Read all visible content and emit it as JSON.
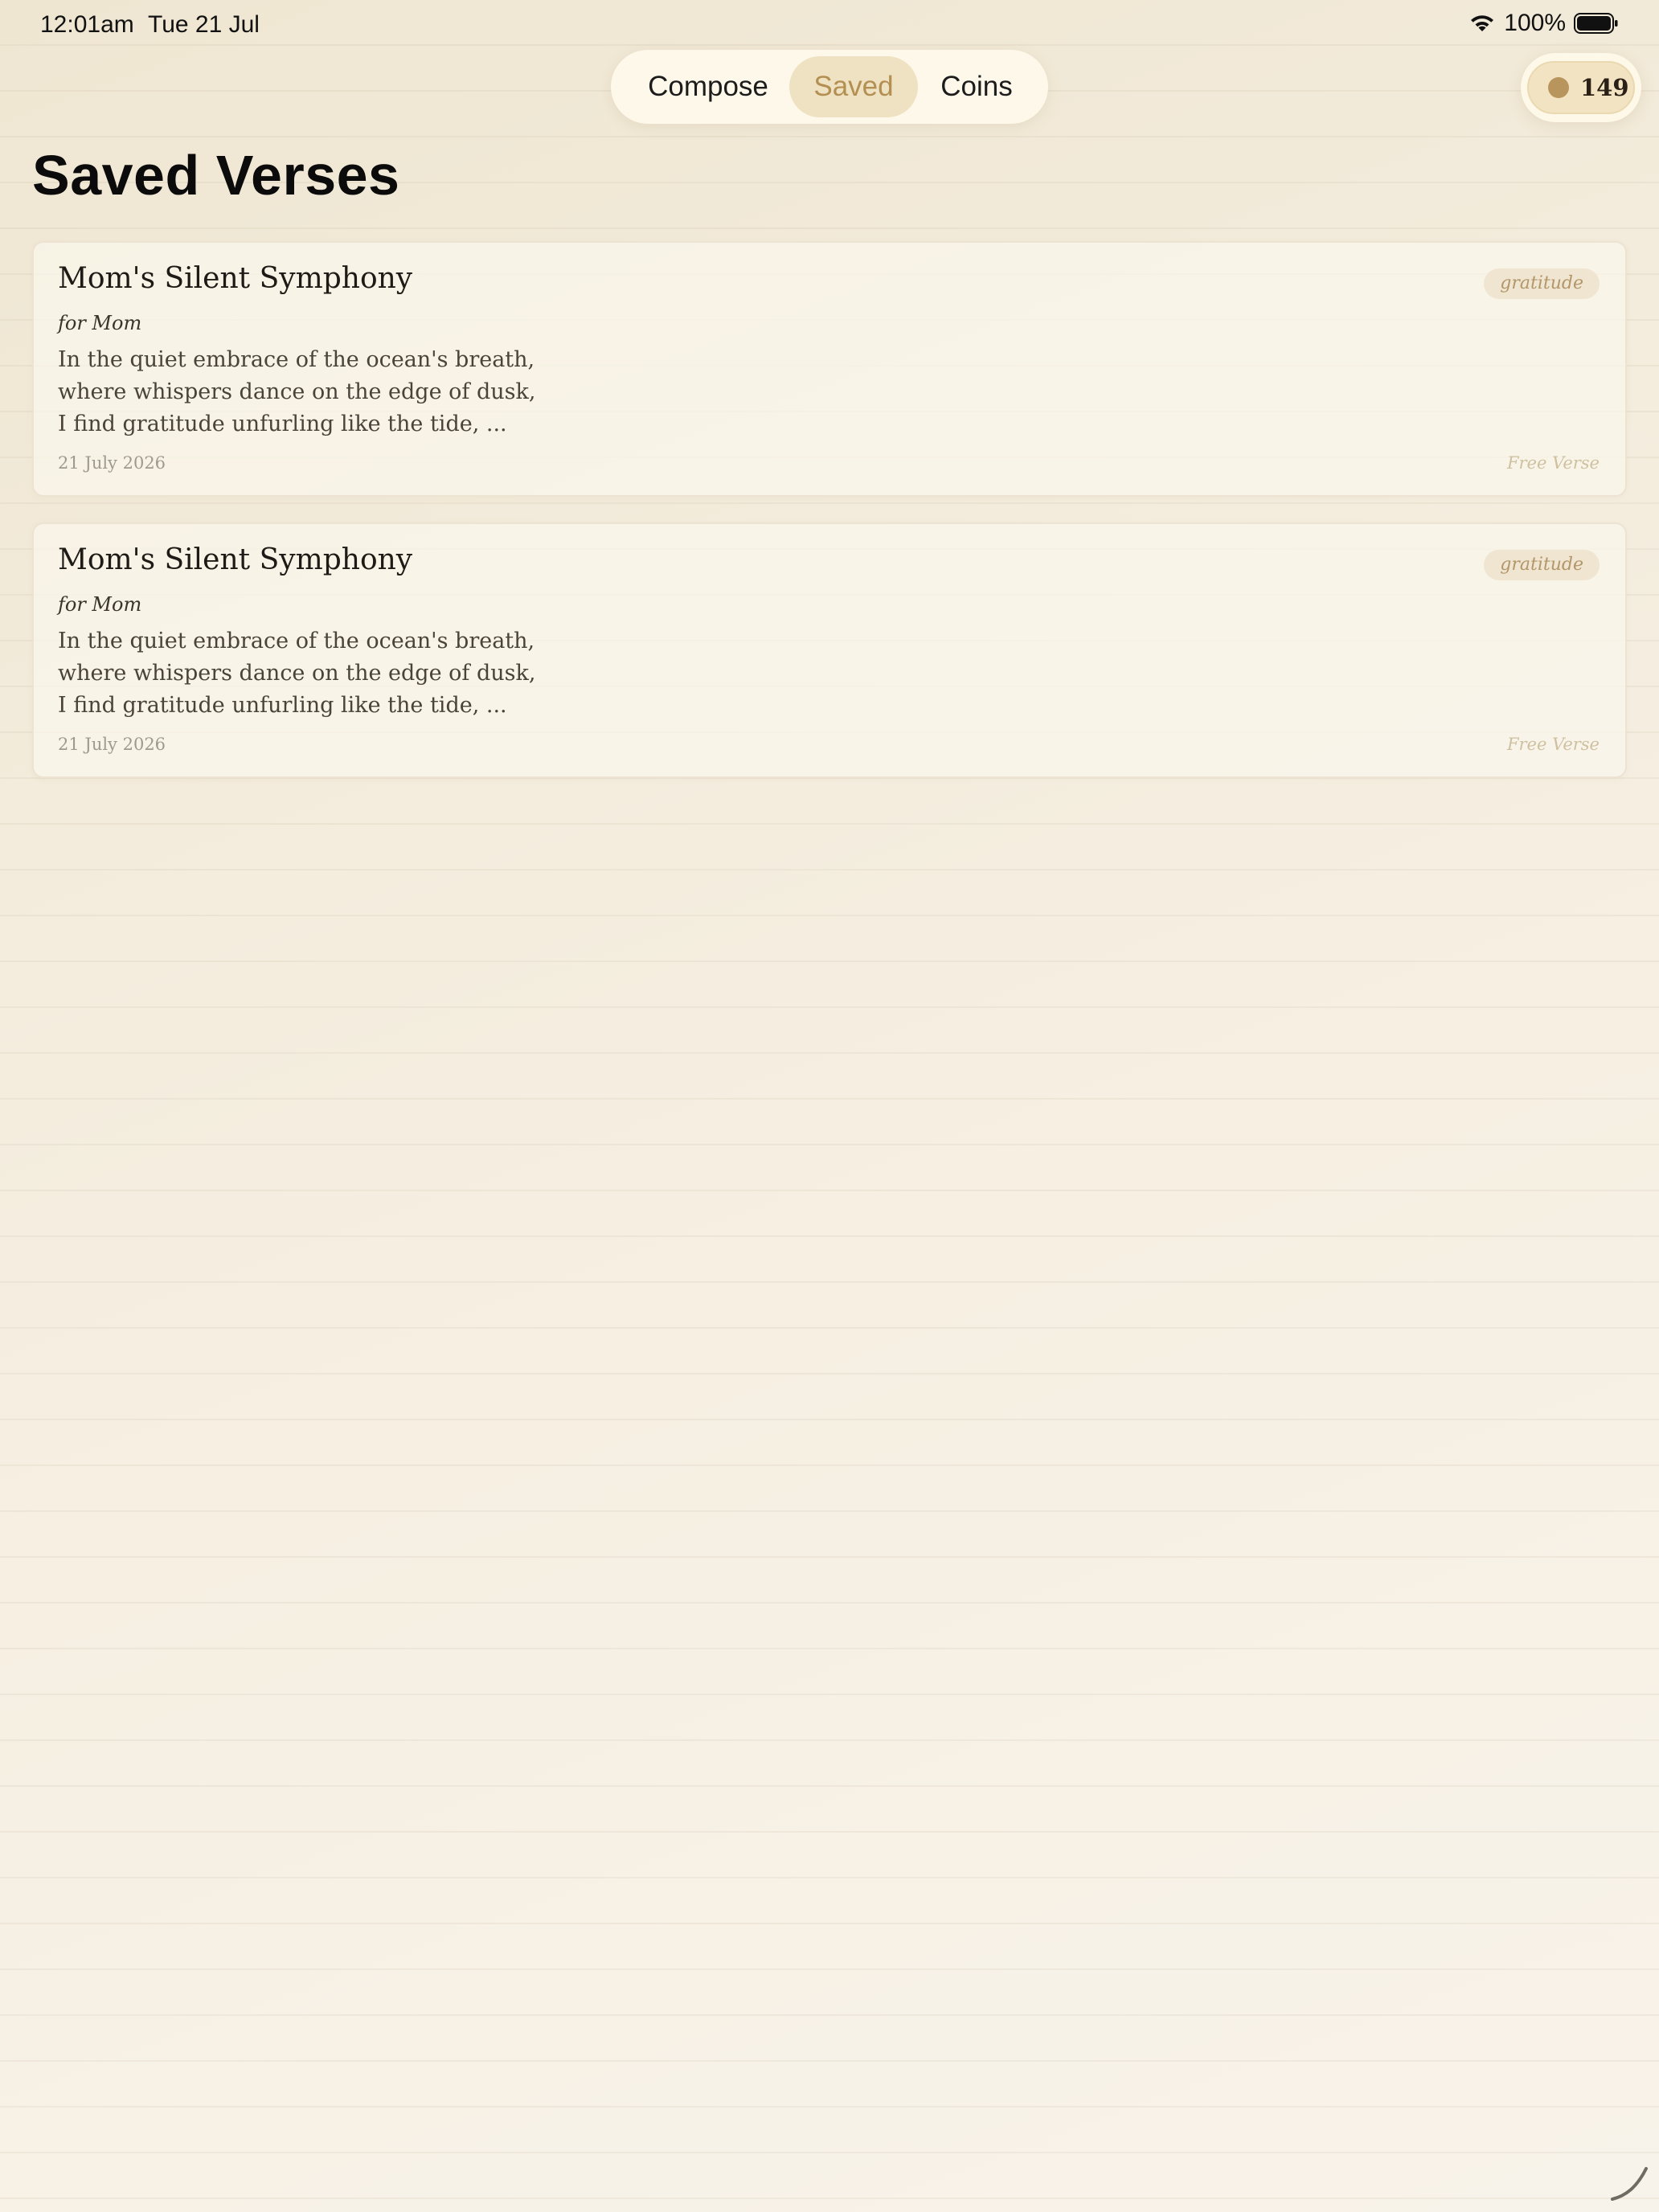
{
  "status_bar": {
    "time": "12:01am",
    "date": "Tue 21 Jul",
    "battery": "100%"
  },
  "nav": {
    "tabs": [
      {
        "label": "Compose",
        "selected": false
      },
      {
        "label": "Saved",
        "selected": true
      },
      {
        "label": "Coins",
        "selected": false
      }
    ]
  },
  "coins": {
    "count": "149"
  },
  "page": {
    "title": "Saved Verses"
  },
  "verses": [
    {
      "title": "Mom's Silent Symphony",
      "tag": "gratitude",
      "recipient": "for Mom",
      "excerpt": [
        "In the quiet embrace of the ocean's breath,",
        "where whispers dance on the edge of dusk,",
        "I find gratitude unfurling like the tide,  ..."
      ],
      "date": "21 July 2026",
      "form": "Free Verse"
    },
    {
      "title": "Mom's Silent Symphony",
      "tag": "gratitude",
      "recipient": "for Mom",
      "excerpt": [
        "In the quiet embrace of the ocean's breath,",
        "where whispers dance on the edge of dusk,",
        "I find gratitude unfurling like the tide,  ..."
      ],
      "date": "21 July 2026",
      "form": "Free Verse"
    }
  ],
  "colors": {
    "accent": "#b48f52",
    "selected_tab_bg": "#efe2c2",
    "coin": "#b8955c",
    "background": "#f5efe2"
  },
  "icons": [
    "wifi-icon",
    "battery-icon",
    "coin-icon",
    "page-curl-icon"
  ]
}
